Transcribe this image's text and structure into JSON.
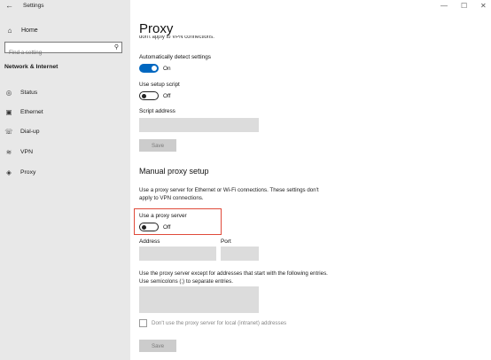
{
  "window": {
    "title": "Settings",
    "back_glyph": "←",
    "min_glyph": "—",
    "max_glyph": "☐",
    "close_glyph": "✕"
  },
  "sidebar": {
    "home_label": "Home",
    "search_placeholder": "Find a setting",
    "section_title": "Network & Internet",
    "items": [
      {
        "label": "Status",
        "icon": "globe-status-icon"
      },
      {
        "label": "Ethernet",
        "icon": "ethernet-icon"
      },
      {
        "label": "Dial-up",
        "icon": "dialup-icon"
      },
      {
        "label": "VPN",
        "icon": "vpn-icon"
      },
      {
        "label": "Proxy",
        "icon": "globe-icon"
      }
    ]
  },
  "main": {
    "title": "Proxy",
    "clipped_text": "don't apply to VPN connections.",
    "auto_detect": {
      "label": "Automatically detect settings",
      "state": "On",
      "on": true
    },
    "setup_script": {
      "label": "Use setup script",
      "state": "Off",
      "on": false
    },
    "script_address": {
      "label": "Script address",
      "value": ""
    },
    "save1_label": "Save",
    "manual_heading": "Manual proxy setup",
    "manual_desc": "Use a proxy server for Ethernet or Wi-Fi connections. These settings don't apply to VPN connections.",
    "use_proxy": {
      "label": "Use a proxy server",
      "state": "Off",
      "on": false
    },
    "address": {
      "label": "Address",
      "value": ""
    },
    "port": {
      "label": "Port",
      "value": ""
    },
    "exceptions_desc": "Use the proxy server except for addresses that start with the following entries. Use semicolons (;) to separate entries.",
    "exceptions_value": "",
    "local_checkbox_label": "Don't use the proxy server for local (intranet) addresses",
    "save2_label": "Save"
  },
  "colors": {
    "accent": "#0067c0",
    "highlight": "#e04a3a",
    "sidebar_bg": "#e8e8e8"
  }
}
